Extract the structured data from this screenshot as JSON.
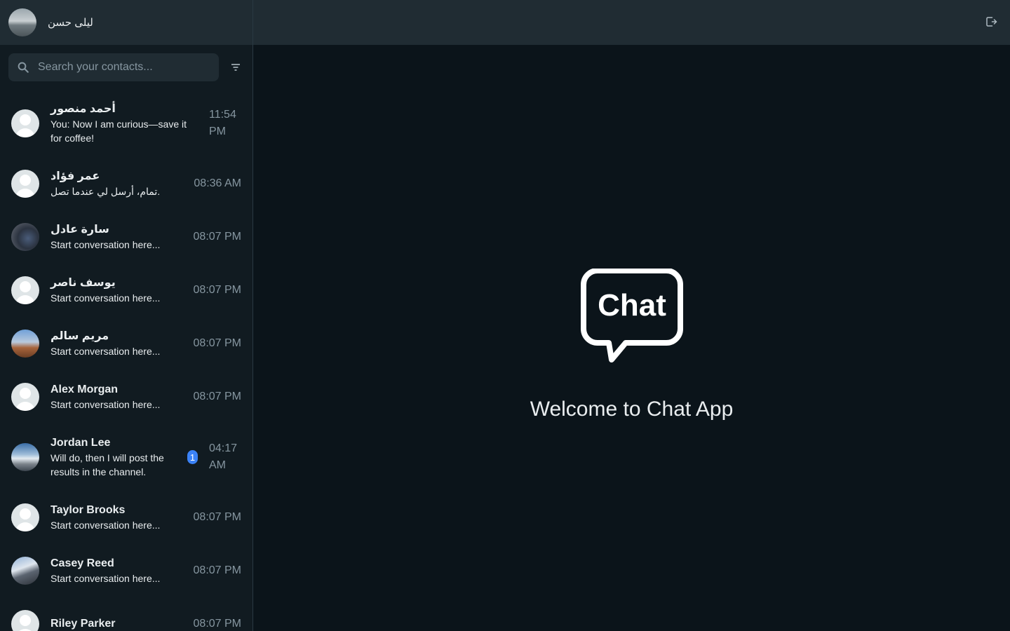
{
  "user": {
    "name": "ليلى حسن"
  },
  "search": {
    "placeholder": "Search your contacts..."
  },
  "contacts": [
    {
      "name": "أحمد منصور",
      "message": "You: Now I am curious—save it for coffee!",
      "time": "11:54 PM",
      "avatar": "default",
      "unread": ""
    },
    {
      "name": "عمر فؤاد",
      "message": "تمام، أرسل لي عندما تصل.",
      "time": "08:36 AM",
      "avatar": "default",
      "unread": ""
    },
    {
      "name": "سارة عادل",
      "message": "Start conversation here...",
      "time": "08:07 PM",
      "avatar": "photo",
      "unread": ""
    },
    {
      "name": "يوسف ناصر",
      "message": "Start conversation here...",
      "time": "08:07 PM",
      "avatar": "default",
      "unread": ""
    },
    {
      "name": "مريم سالم",
      "message": "Start conversation here...",
      "time": "08:07 PM",
      "avatar": "photo",
      "unread": ""
    },
    {
      "name": "Alex Morgan",
      "message": "Start conversation here...",
      "time": "08:07 PM",
      "avatar": "default",
      "unread": ""
    },
    {
      "name": "Jordan Lee",
      "message": "Will do, then I will post the results in the channel.",
      "time": "04:17 AM",
      "avatar": "photo",
      "unread": "1"
    },
    {
      "name": "Taylor Brooks",
      "message": "Start conversation here...",
      "time": "08:07 PM",
      "avatar": "default",
      "unread": ""
    },
    {
      "name": "Casey Reed",
      "message": "Start conversation here...",
      "time": "08:07 PM",
      "avatar": "photo",
      "unread": ""
    },
    {
      "name": "Riley Parker",
      "message": "",
      "time": "08:07 PM",
      "avatar": "default",
      "unread": ""
    }
  ],
  "welcome": {
    "logo_text": "Chat",
    "title": "Welcome to Chat App"
  },
  "colors": {
    "accent": "#3b82f6",
    "sidebar_bg": "#111b21",
    "header_bg": "#202c33",
    "main_bg": "#0b141a"
  },
  "icons": {
    "search": "search-icon",
    "filter": "filter-icon",
    "logout": "logout-icon"
  }
}
